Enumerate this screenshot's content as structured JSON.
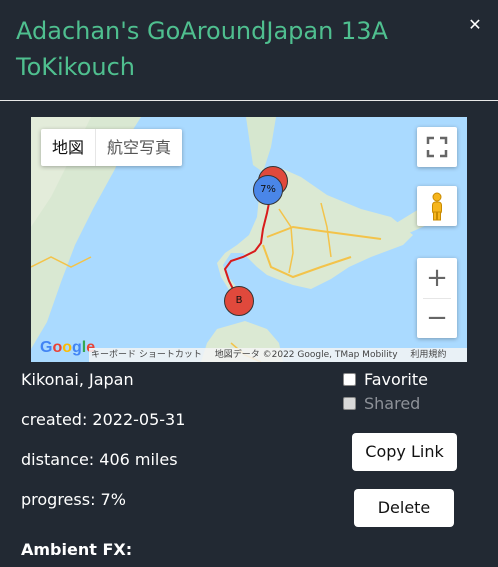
{
  "header": {
    "title": "Adachan's GoAroundJapan 13A ToKikouch",
    "close_icon": "close-icon"
  },
  "map": {
    "maptype_map": "地図",
    "maptype_satellite": "航空写真",
    "fullscreen_icon": "fullscreen-icon",
    "pegman_icon": "pegman-icon",
    "zoom_in": "+",
    "zoom_out": "−",
    "logo": "Google",
    "attribution": {
      "shortcuts": "キーボード ショートカット",
      "map_data": "地図データ ©2022 Google, TMap Mobility",
      "terms": "利用規約"
    },
    "markers": [
      {
        "label": "",
        "color": "#e0493c"
      },
      {
        "label": "7%",
        "color": "#4a86e8"
      },
      {
        "label": "B",
        "color": "#e0493c"
      }
    ],
    "route_color": "#d81b1b"
  },
  "details": {
    "location": "Kikonai, Japan",
    "created": "created: 2022-05-31",
    "distance": "distance: 406 miles",
    "progress": "progress: 7%",
    "ambient_label": "Ambient FX:"
  },
  "options": {
    "favorite": "Favorite",
    "shared": "Shared"
  },
  "actions": {
    "copy_link": "Copy Link",
    "delete": "Delete"
  },
  "colors": {
    "background": "#222933",
    "title": "#4fbf8f"
  }
}
